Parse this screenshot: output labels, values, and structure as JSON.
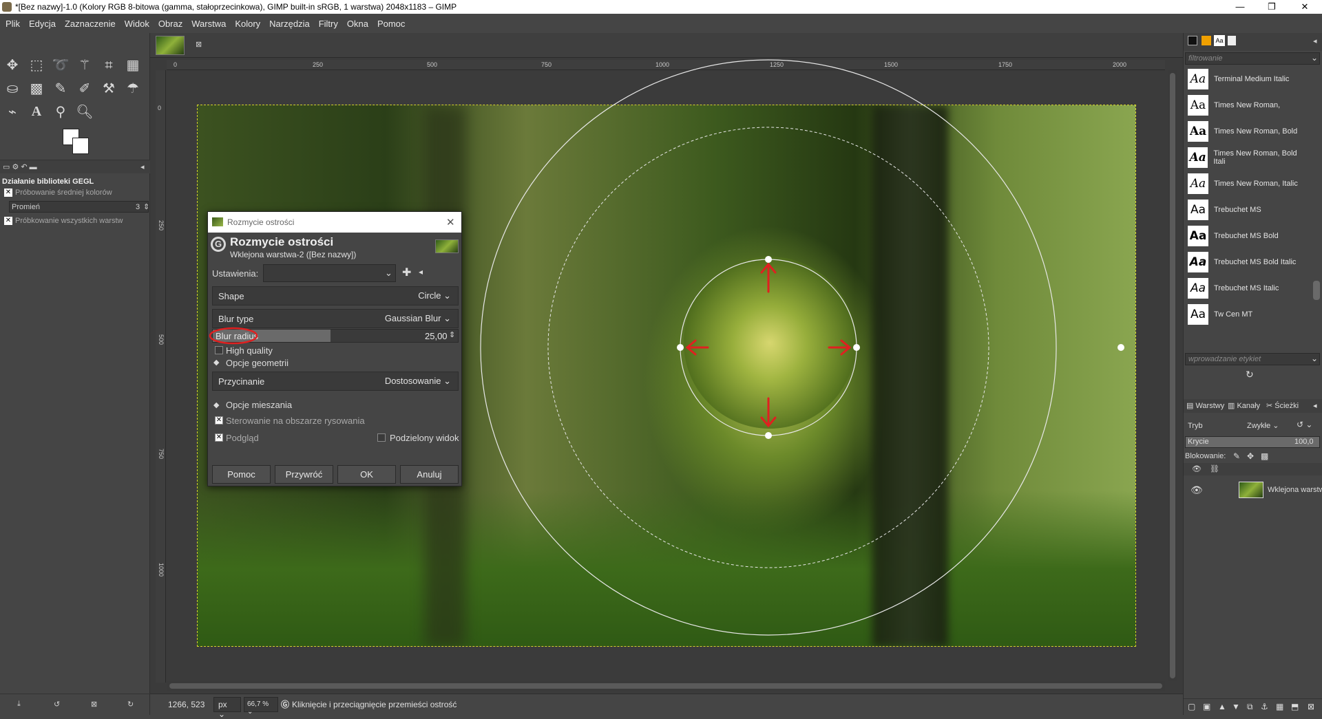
{
  "window": {
    "title": "*[Bez nazwy]-1.0 (Kolory RGB 8-bitowa (gamma, stałoprzecinkowa), GIMP built-in sRGB, 1 warstwa) 2048x1183 – GIMP",
    "minimize": "—",
    "maximize": "❐",
    "close": "✕"
  },
  "menu": [
    "Plik",
    "Edycja",
    "Zaznaczenie",
    "Widok",
    "Obraz",
    "Warstwa",
    "Kolory",
    "Narzędzia",
    "Filtry",
    "Okna",
    "Pomoc"
  ],
  "tool_options": {
    "title": "Działanie biblioteki GEGL",
    "sample_average": "Próbowanie średniej kolorów",
    "radius_label": "Promień",
    "radius_value": "3",
    "sample_merged": "Próbkowanie wszystkich warstw"
  },
  "ruler": {
    "h_ticks": [
      "0",
      "250",
      "500",
      "750",
      "1000",
      "1250",
      "1500",
      "1750",
      "2000"
    ],
    "v_ticks": [
      "0",
      "250",
      "500",
      "750",
      "1000"
    ]
  },
  "dialog": {
    "window_title": "Rozmycie ostrości",
    "heading": "Rozmycie ostrości",
    "subheading": "Wklejona warstwa-2 ([Bez nazwy])",
    "settings_label": "Ustawienia:",
    "shape_label": "Shape",
    "shape_value": "Circle",
    "blur_type_label": "Blur type",
    "blur_type_value": "Gaussian Blur",
    "blur_radius_label": "Blur radius",
    "blur_radius_value": "25,00",
    "blur_radius_fraction": 0.48,
    "high_quality": "High quality",
    "geometry_options": "Opcje geometrii",
    "clipping_label": "Przycinanie",
    "clipping_value": "Dostosowanie",
    "blending_options": "Opcje mieszania",
    "on_canvas_controls": "Sterowanie na obszarze rysowania",
    "preview": "Podgląd",
    "split_view": "Podzielony widok",
    "buttons": {
      "help": "Pomoc",
      "reset": "Przywróć",
      "ok": "OK",
      "cancel": "Anuluj"
    }
  },
  "fonts_panel": {
    "filter_placeholder": "filtrowanie",
    "tags_placeholder": "wprowadzanie etykiet",
    "sample": "Aa",
    "fonts": [
      "Terminal Medium Italic",
      "Times New Roman,",
      "Times New Roman, Bold",
      "Times New Roman, Bold Itali",
      "Times New Roman, Italic",
      "Trebuchet MS",
      "Trebuchet MS Bold",
      "Trebuchet MS Bold Italic",
      "Trebuchet MS Italic",
      "Tw Cen MT"
    ]
  },
  "layers_panel": {
    "tabs": [
      "Warstwy",
      "Kanały",
      "Ścieżki"
    ],
    "mode_label": "Tryb",
    "mode_value": "Zwykłe",
    "opacity_label": "Krycie",
    "opacity_value": "100,0",
    "lock_label": "Blokowanie:",
    "layer_name": "Wklejona warstw"
  },
  "status": {
    "coords": "1266, 523",
    "unit": "px",
    "zoom": "66,7 %",
    "message": "Kliknięcie i przeciągnięcie przemieści ostrość"
  },
  "colors": {
    "annotation_red": "#e02020",
    "selection_yellow": "#d6d62a"
  }
}
